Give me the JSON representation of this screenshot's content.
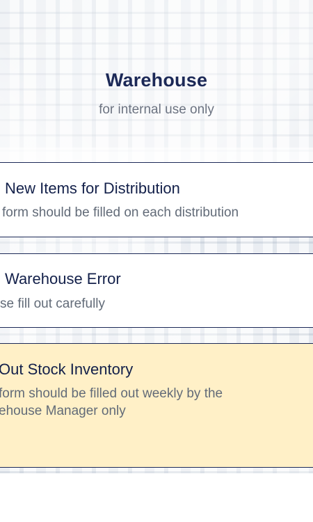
{
  "header": {
    "title": "Warehouse",
    "subtitle": "for internal use only"
  },
  "cards": [
    {
      "title": "New Items for Distribution",
      "description": "form should be filled on each distribution"
    },
    {
      "title": "Warehouse Error",
      "description": "se fill out carefully"
    },
    {
      "title": "Out Stock Inventory",
      "description_line1": "form should be filled out weekly by the",
      "description_line2": "ehouse Manager only"
    }
  ],
  "colors": {
    "primary_text": "#1c2957",
    "secondary_text": "#626b78",
    "highlight_card": "#fff0c7",
    "border": "#1c2957"
  }
}
